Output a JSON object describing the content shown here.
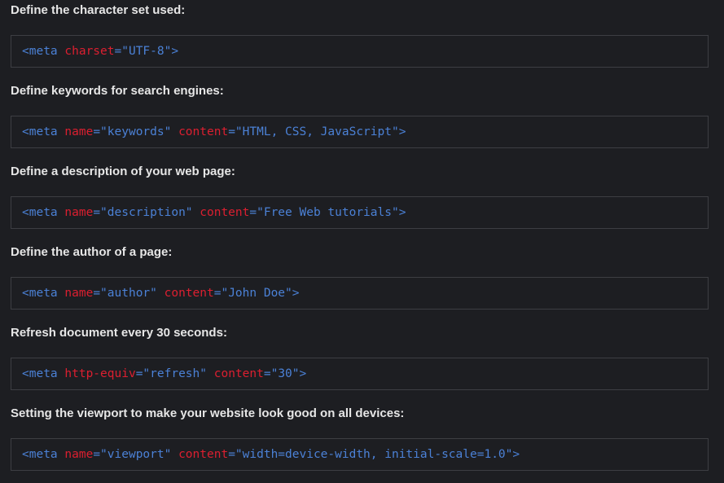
{
  "examples": [
    {
      "heading": "Define the character set used:",
      "tokens": [
        {
          "type": "tag",
          "text": "<meta"
        },
        {
          "type": "plain",
          "text": " "
        },
        {
          "type": "attr",
          "text": "charset"
        },
        {
          "type": "val",
          "text": "=\"UTF-8\""
        },
        {
          "type": "tag",
          "text": ">"
        }
      ]
    },
    {
      "heading": "Define keywords for search engines:",
      "tokens": [
        {
          "type": "tag",
          "text": "<meta"
        },
        {
          "type": "plain",
          "text": " "
        },
        {
          "type": "attr",
          "text": "name"
        },
        {
          "type": "val",
          "text": "=\"keywords\""
        },
        {
          "type": "plain",
          "text": " "
        },
        {
          "type": "attr",
          "text": "content"
        },
        {
          "type": "val",
          "text": "=\"HTML, CSS, JavaScript\""
        },
        {
          "type": "tag",
          "text": ">"
        }
      ]
    },
    {
      "heading": "Define a description of your web page:",
      "tokens": [
        {
          "type": "tag",
          "text": "<meta"
        },
        {
          "type": "plain",
          "text": " "
        },
        {
          "type": "attr",
          "text": "name"
        },
        {
          "type": "val",
          "text": "=\"description\""
        },
        {
          "type": "plain",
          "text": " "
        },
        {
          "type": "attr",
          "text": "content"
        },
        {
          "type": "val",
          "text": "=\"Free Web tutorials\""
        },
        {
          "type": "tag",
          "text": ">"
        }
      ]
    },
    {
      "heading": "Define the author of a page:",
      "tokens": [
        {
          "type": "tag",
          "text": "<meta"
        },
        {
          "type": "plain",
          "text": " "
        },
        {
          "type": "attr",
          "text": "name"
        },
        {
          "type": "val",
          "text": "=\"author\""
        },
        {
          "type": "plain",
          "text": " "
        },
        {
          "type": "attr",
          "text": "content"
        },
        {
          "type": "val",
          "text": "=\"John Doe\""
        },
        {
          "type": "tag",
          "text": ">"
        }
      ]
    },
    {
      "heading": "Refresh document every 30 seconds:",
      "tokens": [
        {
          "type": "tag",
          "text": "<meta"
        },
        {
          "type": "plain",
          "text": " "
        },
        {
          "type": "attr",
          "text": "http-equiv"
        },
        {
          "type": "val",
          "text": "=\"refresh\""
        },
        {
          "type": "plain",
          "text": " "
        },
        {
          "type": "attr",
          "text": "content"
        },
        {
          "type": "val",
          "text": "=\"30\""
        },
        {
          "type": "tag",
          "text": ">"
        }
      ]
    },
    {
      "heading": "Setting the viewport to make your website look good on all devices:",
      "tokens": [
        {
          "type": "tag",
          "text": "<meta"
        },
        {
          "type": "plain",
          "text": " "
        },
        {
          "type": "attr",
          "text": "name"
        },
        {
          "type": "val",
          "text": "=\"viewport\""
        },
        {
          "type": "plain",
          "text": " "
        },
        {
          "type": "attr",
          "text": "content"
        },
        {
          "type": "val",
          "text": "=\"width=device-width, initial-scale=1.0\""
        },
        {
          "type": "tag",
          "text": ">"
        }
      ]
    }
  ],
  "colors": {
    "background": "#1d1e22",
    "heading_text": "#e6e6e6",
    "tag": "#4b81d6",
    "attribute": "#dc1f30",
    "value": "#4b81d6",
    "box_border": "#3d3e43"
  }
}
